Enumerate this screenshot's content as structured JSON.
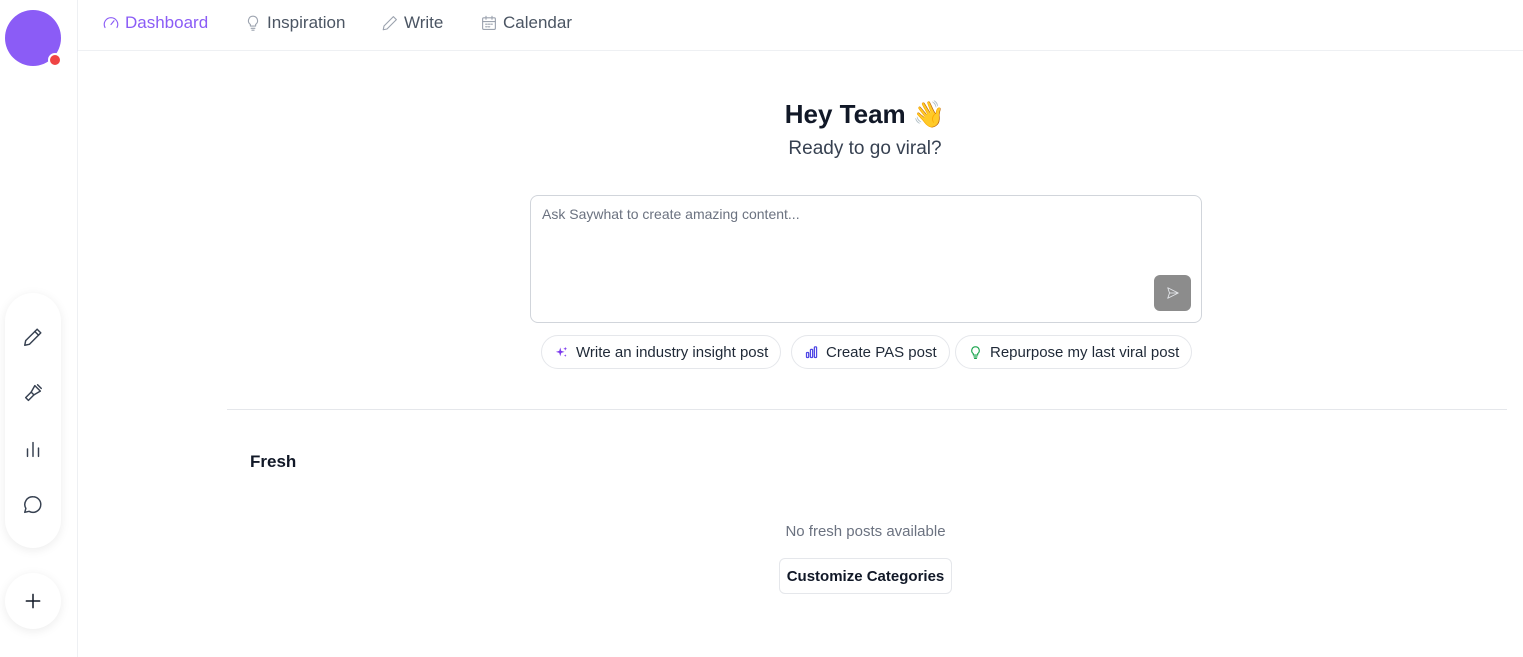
{
  "nav": {
    "items": [
      {
        "label": "Dashboard",
        "icon": "gauge-icon",
        "active": true
      },
      {
        "label": "Inspiration",
        "icon": "lightbulb-icon",
        "active": false
      },
      {
        "label": "Write",
        "icon": "pencil-icon",
        "active": false
      },
      {
        "label": "Calendar",
        "icon": "calendar-icon",
        "active": false
      }
    ]
  },
  "sidebar": {
    "avatar_notification": true,
    "tools": [
      {
        "icon": "pencil-icon"
      },
      {
        "icon": "paintbrush-icon"
      },
      {
        "icon": "bar-chart-icon"
      },
      {
        "icon": "chat-bubble-icon"
      }
    ],
    "add_icon": "plus-icon"
  },
  "hero": {
    "title": "Hey Team 👋",
    "subtitle": "Ready to go viral?"
  },
  "prompt": {
    "placeholder": "Ask Saywhat to create amazing content...",
    "value": "",
    "send_icon": "send-icon"
  },
  "suggestions": [
    {
      "label": "Write an industry insight post",
      "icon": "sparkles-icon",
      "color": "#7c3aed"
    },
    {
      "label": "Create PAS post",
      "icon": "bar-chart-icon",
      "color": "#4f46e5"
    },
    {
      "label": "Repurpose my last viral post",
      "icon": "lightbulb-icon",
      "color": "#16a34a"
    }
  ],
  "fresh": {
    "title": "Fresh",
    "empty_message": "No fresh posts available",
    "customize_label": "Customize Categories"
  },
  "colors": {
    "accent": "#8b5cf6",
    "notification": "#ef4444"
  }
}
